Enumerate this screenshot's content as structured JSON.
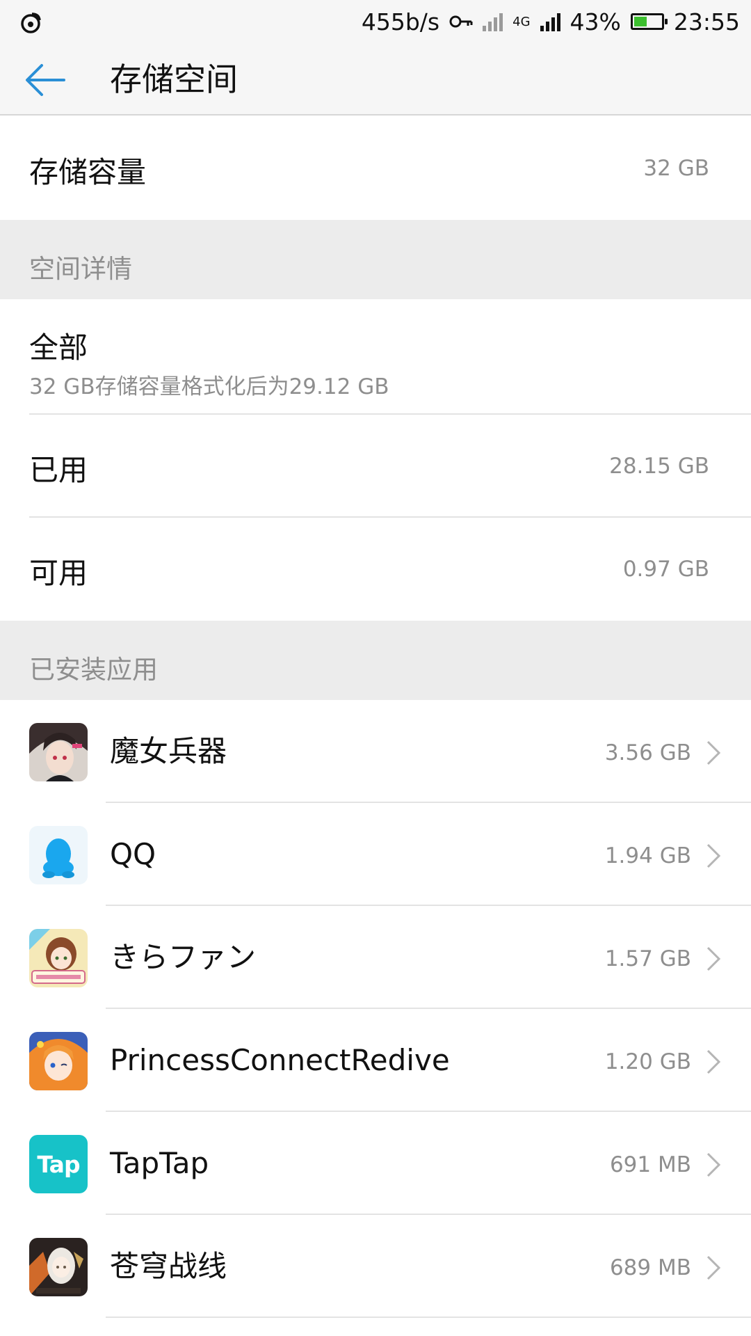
{
  "status_bar": {
    "speed": "455b/s",
    "network": "4G",
    "battery": "43%",
    "battery_level": 0.43,
    "time": "23:55"
  },
  "header": {
    "title": "存储空间"
  },
  "capacity": {
    "label": "存储容量",
    "value": "32 GB"
  },
  "details_section": {
    "title": "空间详情"
  },
  "all": {
    "label": "全部",
    "sub": "32 GB存储容量格式化后为29.12 GB"
  },
  "used": {
    "label": "已用",
    "value": "28.15 GB"
  },
  "available": {
    "label": "可用",
    "value": "0.97 GB"
  },
  "apps_section": {
    "title": "已安装应用"
  },
  "apps": [
    {
      "name": "魔女兵器",
      "size": "3.56 GB"
    },
    {
      "name": "QQ",
      "size": "1.94 GB"
    },
    {
      "name": "きらファン",
      "size": "1.57 GB"
    },
    {
      "name": "PrincessConnectRedive",
      "size": "1.20 GB"
    },
    {
      "name": "TapTap",
      "size": "691 MB",
      "icon_text": "Tap"
    },
    {
      "name": "苍穹战线",
      "size": "689 MB"
    }
  ],
  "colors": {
    "accent": "#2a8fd6",
    "taptap": "#17c2c8",
    "qq": "#1aa7ee"
  },
  "icons": {
    "back": "arrow-left-icon",
    "chevron": "chevron-right-icon"
  }
}
